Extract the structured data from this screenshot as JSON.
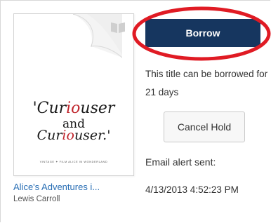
{
  "cover": {
    "title_line1_a": "'Cur",
    "title_line1_red": "io",
    "title_line1_b": "user",
    "title_line2": "and",
    "title_line3_a": "Cur",
    "title_line3_red": "io",
    "title_line3_b": "user.'",
    "credit": "VINTAGE ✦ FILM  ALICE IN WONDERLAND",
    "icons": [
      "book-icon",
      "page-curl-icon"
    ]
  },
  "book": {
    "title": "Alice's Adventures i...",
    "author": "Lewis Carroll"
  },
  "actions": {
    "borrow_label": "Borrow",
    "availability_text": "This title can be borrowed for 21 days",
    "cancel_hold_label": "Cancel Hold"
  },
  "alert": {
    "label": "Email alert sent:",
    "date": "4/13/2013 4:52:23 PM"
  },
  "colors": {
    "borrow_button": "#16365f",
    "highlight": "#e01b24",
    "link": "#2a6fb5"
  }
}
